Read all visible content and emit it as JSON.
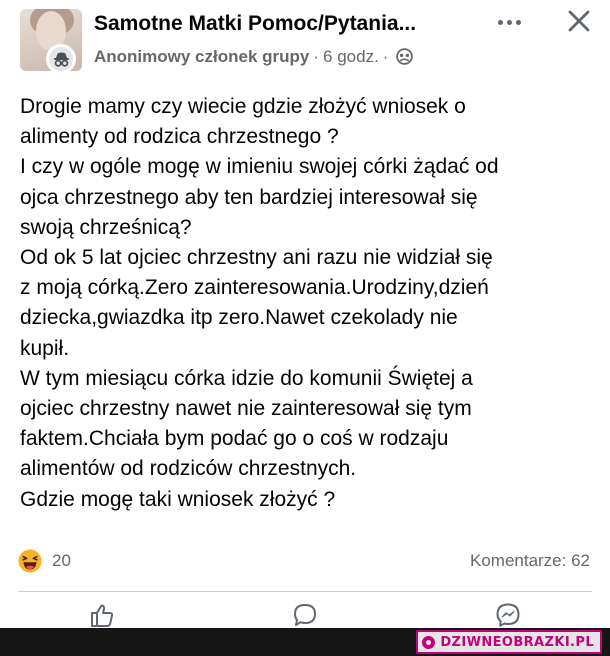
{
  "post": {
    "group_name": "Samotne Matki Pomoc/Pytania...",
    "author": "Anonimowy członek grupy",
    "time": "6 godz.",
    "separator": "·",
    "body_lines": [
      "Drogie mamy czy wiecie gdzie złożyć wniosek o",
      "alimenty od rodzica chrzestnego ?",
      "I czy w ogóle mogę w imieniu swojej córki żądać od",
      "ojca chrzestnego  aby ten bardziej interesował się",
      "swoją chrześnicą?",
      "Od ok 5 lat ojciec chrzestny ani razu nie widział się",
      "z moją córką.Zero zainteresowania.Urodziny,dzień",
      "dziecka,gwiazdka itp zero.Nawet czekolady nie",
      "kupił.",
      "W tym miesiącu córka idzie do komunii Świętej a",
      "ojciec chrzestny nawet nie zainteresował się tym",
      "faktem.Chciała bym podać go o coś w rodzaju",
      "alimentów od rodziców chrzestnych.",
      "Gdzie mogę taki wniosek złożyć ?"
    ],
    "reaction_count": "20",
    "comments_label": "Komentarze: 62",
    "icons": {
      "more": "more-options-icon",
      "close": "close-icon",
      "audience": "group-audience-icon",
      "anonymous": "anonymous-member-icon",
      "reaction": "haha-reaction-icon",
      "like": "like-icon",
      "comment": "comment-icon",
      "messenger": "messenger-icon"
    }
  },
  "watermark": {
    "text": "DZIWNEOBRAZKI.PL",
    "color": "#c4007c"
  },
  "colors": {
    "text": "#050505",
    "secondary": "#65676b",
    "divider": "#ced0d4",
    "haha": "#f7b125"
  }
}
